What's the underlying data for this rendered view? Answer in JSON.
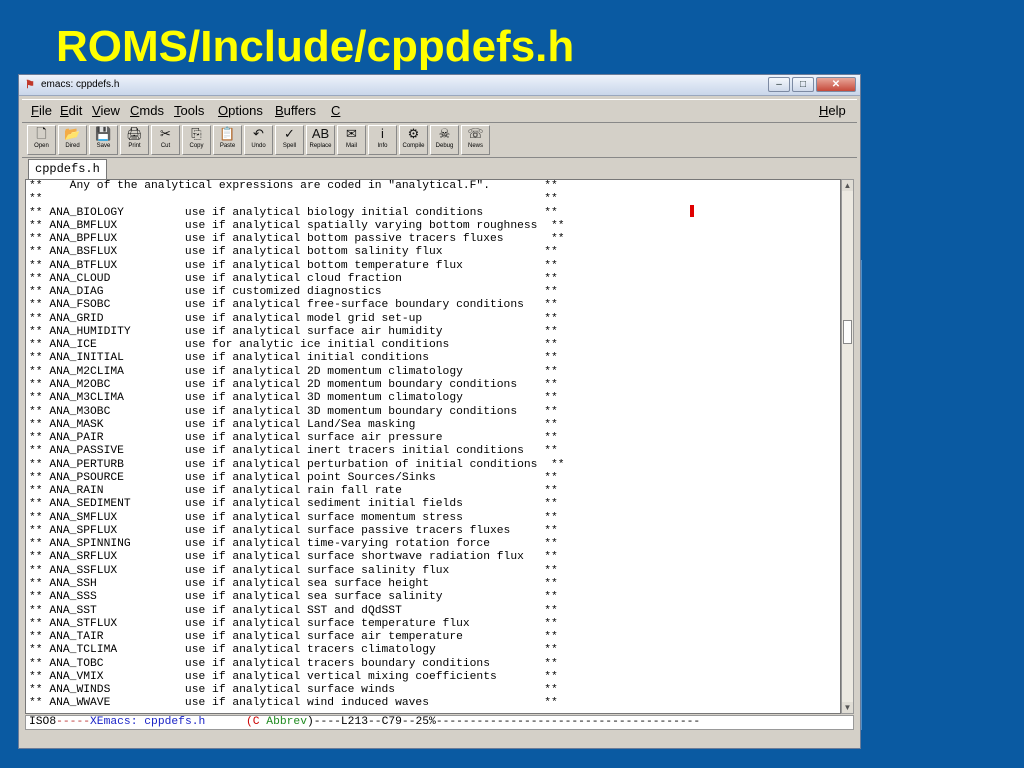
{
  "slide_title": "ROMS/Include/cppdefs.h",
  "window": {
    "title": "emacs: cppdefs.h"
  },
  "winbuttons": {
    "minimize": "–",
    "maximize": "□",
    "close": "✕"
  },
  "menu": [
    {
      "label": "File",
      "u": "F",
      "rest": "ile"
    },
    {
      "label": "Edit",
      "u": "E",
      "rest": "dit"
    },
    {
      "label": "View",
      "u": "V",
      "rest": "iew"
    },
    {
      "label": "Cmds",
      "u": "C",
      "rest": "mds"
    },
    {
      "label": "Tools",
      "u": "T",
      "rest": "ools"
    },
    {
      "label": "Options",
      "u": "O",
      "rest": "ptions"
    },
    {
      "label": "Buffers",
      "u": "B",
      "rest": "uffers"
    },
    {
      "label": "C",
      "u": "C",
      "rest": ""
    }
  ],
  "menu_help": {
    "u": "H",
    "rest": "elp"
  },
  "toolbar": [
    {
      "label": "Open",
      "icon": "open-icon",
      "glyph": "🗋"
    },
    {
      "label": "Dired",
      "icon": "dired-icon",
      "glyph": "📂"
    },
    {
      "label": "Save",
      "icon": "save-icon",
      "glyph": "💾"
    },
    {
      "label": "Print",
      "icon": "print-icon",
      "glyph": "🖨"
    },
    {
      "label": "Cut",
      "icon": "cut-icon",
      "glyph": "✂"
    },
    {
      "label": "Copy",
      "icon": "copy-icon",
      "glyph": "⎘"
    },
    {
      "label": "Paste",
      "icon": "paste-icon",
      "glyph": "📋"
    },
    {
      "label": "Undo",
      "icon": "undo-icon",
      "glyph": "↶"
    },
    {
      "label": "Spell",
      "icon": "spell-icon",
      "glyph": "✓"
    },
    {
      "label": "Replace",
      "icon": "replace-icon",
      "glyph": "AB"
    },
    {
      "label": "Mail",
      "icon": "mail-icon",
      "glyph": "✉"
    },
    {
      "label": "Info",
      "icon": "info-icon",
      "glyph": "i"
    },
    {
      "label": "Compile",
      "icon": "compile-icon",
      "glyph": "⚙"
    },
    {
      "label": "Debug",
      "icon": "debug-icon",
      "glyph": "☠"
    },
    {
      "label": "News",
      "icon": "news-icon",
      "glyph": "☏"
    }
  ],
  "tab_label": "cppdefs.h",
  "code_lines": [
    "**    Any of the analytical expressions are coded in \"analytical.F\".        **",
    "**                                                                          **",
    "** ANA_BIOLOGY         use if analytical biology initial conditions         **",
    "** ANA_BMFLUX          use if analytical spatially varying bottom roughness  **",
    "** ANA_BPFLUX          use if analytical bottom passive tracers fluxes       **",
    "** ANA_BSFLUX          use if analytical bottom salinity flux               **",
    "** ANA_BTFLUX          use if analytical bottom temperature flux            **",
    "** ANA_CLOUD           use if analytical cloud fraction                     **",
    "** ANA_DIAG            use if customized diagnostics                        **",
    "** ANA_FSOBC           use if analytical free-surface boundary conditions   **",
    "** ANA_GRID            use if analytical model grid set-up                  **",
    "** ANA_HUMIDITY        use if analytical surface air humidity               **",
    "** ANA_ICE             use for analytic ice initial conditions              **",
    "** ANA_INITIAL         use if analytical initial conditions                 **",
    "** ANA_M2CLIMA         use if analytical 2D momentum climatology            **",
    "** ANA_M2OBC           use if analytical 2D momentum boundary conditions    **",
    "** ANA_M3CLIMA         use if analytical 3D momentum climatology            **",
    "** ANA_M3OBC           use if analytical 3D momentum boundary conditions    **",
    "** ANA_MASK            use if analytical Land/Sea masking                   **",
    "** ANA_PAIR            use if analytical surface air pressure               **",
    "** ANA_PASSIVE         use if analytical inert tracers initial conditions   **",
    "** ANA_PERTURB         use if analytical perturbation of initial conditions  **",
    "** ANA_PSOURCE         use if analytical point Sources/Sinks                **",
    "** ANA_RAIN            use if analytical rain fall rate                     **",
    "** ANA_SEDIMENT        use if analytical sediment initial fields            **",
    "** ANA_SMFLUX          use if analytical surface momentum stress            **",
    "** ANA_SPFLUX          use if analytical surface passive tracers fluxes     **",
    "** ANA_SPINNING        use if analytical time-varying rotation force        **",
    "** ANA_SRFLUX          use if analytical surface shortwave radiation flux   **",
    "** ANA_SSFLUX          use if analytical surface salinity flux              **",
    "** ANA_SSH             use if analytical sea surface height                 **",
    "** ANA_SSS             use if analytical sea surface salinity               **",
    "** ANA_SST             use if analytical SST and dQdSST                     **",
    "** ANA_STFLUX          use if analytical surface temperature flux           **",
    "** ANA_TAIR            use if analytical surface air temperature            **",
    "** ANA_TCLIMA          use if analytical tracers climatology                **",
    "** ANA_TOBC            use if analytical tracers boundary conditions        **",
    "** ANA_VMIX            use if analytical vertical mixing coefficients       **",
    "** ANA_WINDS           use if analytical surface winds                      **",
    "** ANA_WWAVE           use if analytical wind induced waves                 **"
  ],
  "modeline": {
    "encoding": "ISO8",
    "dashes1": "-----",
    "buffer": "XEmacs: cppdefs.h",
    "gap": "      ",
    "paren_open": "(",
    "mode_c": "C",
    "mode_rest": " Abbrev",
    "paren_close": ")",
    "position": "----L213--C79--25%",
    "trail": "---------------------------------------"
  },
  "colors": {
    "background": "#0a5aa2",
    "title": "#ffff00",
    "cursor": "#e00000"
  }
}
